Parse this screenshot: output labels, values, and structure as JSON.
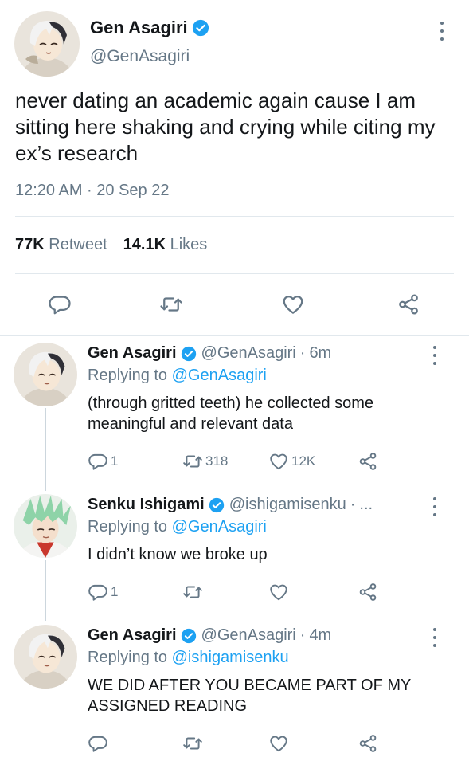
{
  "main_tweet": {
    "display_name": "Gen Asagiri",
    "handle": "@GenAsagiri",
    "text": "never dating an academic again cause I am sitting here shaking and crying while citing my ex’s research",
    "timestamp": "12:20 AM · 20 Sep 22",
    "retweets_count": "77K",
    "retweets_label": "Retweet",
    "likes_count": "14.1K",
    "likes_label": "Likes",
    "icons": [
      "reply-icon",
      "retweet-icon",
      "like-icon",
      "share-icon",
      "more-icon",
      "verified-badge-icon"
    ]
  },
  "replies": [
    {
      "display_name": "Gen Asagiri",
      "handle": "@GenAsagiri",
      "separator": "·",
      "time": "6m",
      "replying_prefix": "Replying to",
      "replying_to": "@GenAsagiri",
      "text": "(through gritted teeth) he collected some meaningful and relevant data",
      "reply_count": "1",
      "retweet_count": "318",
      "like_count": "12K"
    },
    {
      "display_name": "Senku Ishigami",
      "handle": "@ishigamisenku",
      "separator": "·",
      "time": "...",
      "replying_prefix": "Replying to",
      "replying_to": "@GenAsagiri",
      "text": "I didn’t know we broke up",
      "reply_count": "1",
      "retweet_count": "",
      "like_count": ""
    },
    {
      "display_name": "Gen Asagiri",
      "handle": "@GenAsagiri",
      "separator": "·",
      "time": "4m",
      "replying_prefix": "Replying to",
      "replying_to": "@ishigamisenku",
      "text": "WE DID AFTER YOU BECAME PART OF MY ASSIGNED READING",
      "reply_count": "",
      "retweet_count": "",
      "like_count": ""
    }
  ],
  "colors": {
    "link_blue": "#1da1f2",
    "secondary_text": "#657786",
    "primary_text": "#14171a",
    "divider": "#e1e8ed"
  }
}
